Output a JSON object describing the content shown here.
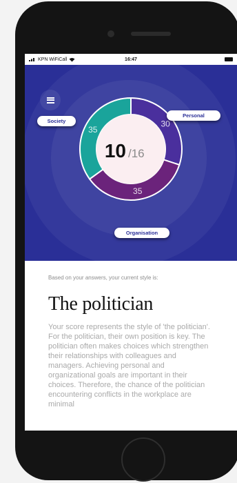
{
  "status_bar": {
    "carrier": "KPN WiFiCall",
    "time": "16:47"
  },
  "score": {
    "value": "10",
    "total": "/16"
  },
  "chart_data": {
    "type": "pie",
    "title": "",
    "segments": [
      {
        "label": "Personal",
        "value": 30,
        "color": "#4a2f9d"
      },
      {
        "label": "Organisation",
        "value": 35,
        "color": "#6b237b"
      },
      {
        "label": "Society",
        "value": 35,
        "color": "#1aa49b"
      }
    ]
  },
  "result": {
    "intro": "Based on your answers, your current style is:",
    "title": "The politician",
    "description": "Your score represents the style of 'the politician'. For the politician, their own position is key. The politician often makes choices which strengthen their relationships with colleagues and managers. Achieving personal and organizational goals are important in their choices. Therefore, the chance of the politician encountering conflicts in the workplace are minimal"
  },
  "colors": {
    "hero_bg": "#2a2f97",
    "society": "#1aa49b",
    "personal": "#4a2f9d",
    "organisation": "#6b237b"
  },
  "icons": {
    "menu": "hamburger-icon",
    "wifi": "wifi-icon",
    "signal": "signal-icon",
    "battery": "battery-icon"
  }
}
